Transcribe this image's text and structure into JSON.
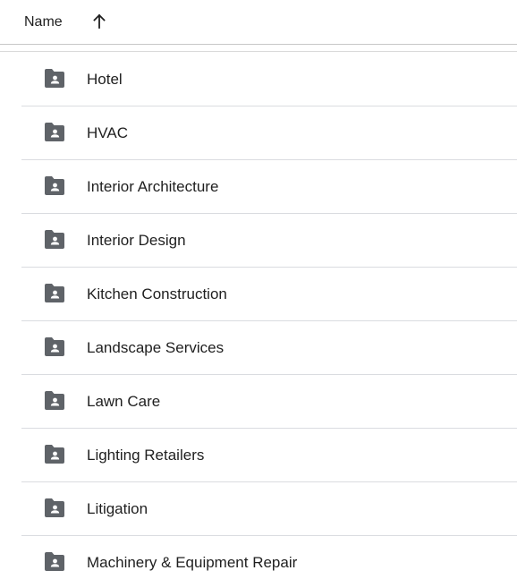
{
  "header": {
    "column_label": "Name",
    "sort_icon": "arrow-up-icon"
  },
  "rows": [
    {
      "label": "Hotel",
      "icon": "shared-folder-icon"
    },
    {
      "label": "HVAC",
      "icon": "shared-folder-icon"
    },
    {
      "label": "Interior Architecture",
      "icon": "shared-folder-icon"
    },
    {
      "label": "Interior Design",
      "icon": "shared-folder-icon"
    },
    {
      "label": "Kitchen Construction",
      "icon": "shared-folder-icon"
    },
    {
      "label": "Landscape Services",
      "icon": "shared-folder-icon"
    },
    {
      "label": "Lawn Care",
      "icon": "shared-folder-icon"
    },
    {
      "label": "Lighting Retailers",
      "icon": "shared-folder-icon"
    },
    {
      "label": "Litigation",
      "icon": "shared-folder-icon"
    },
    {
      "label": "Machinery & Equipment Repair",
      "icon": "shared-folder-icon"
    }
  ],
  "colors": {
    "icon": "#5f6368",
    "text": "#1f1f1f",
    "divider": "#dadce0"
  }
}
